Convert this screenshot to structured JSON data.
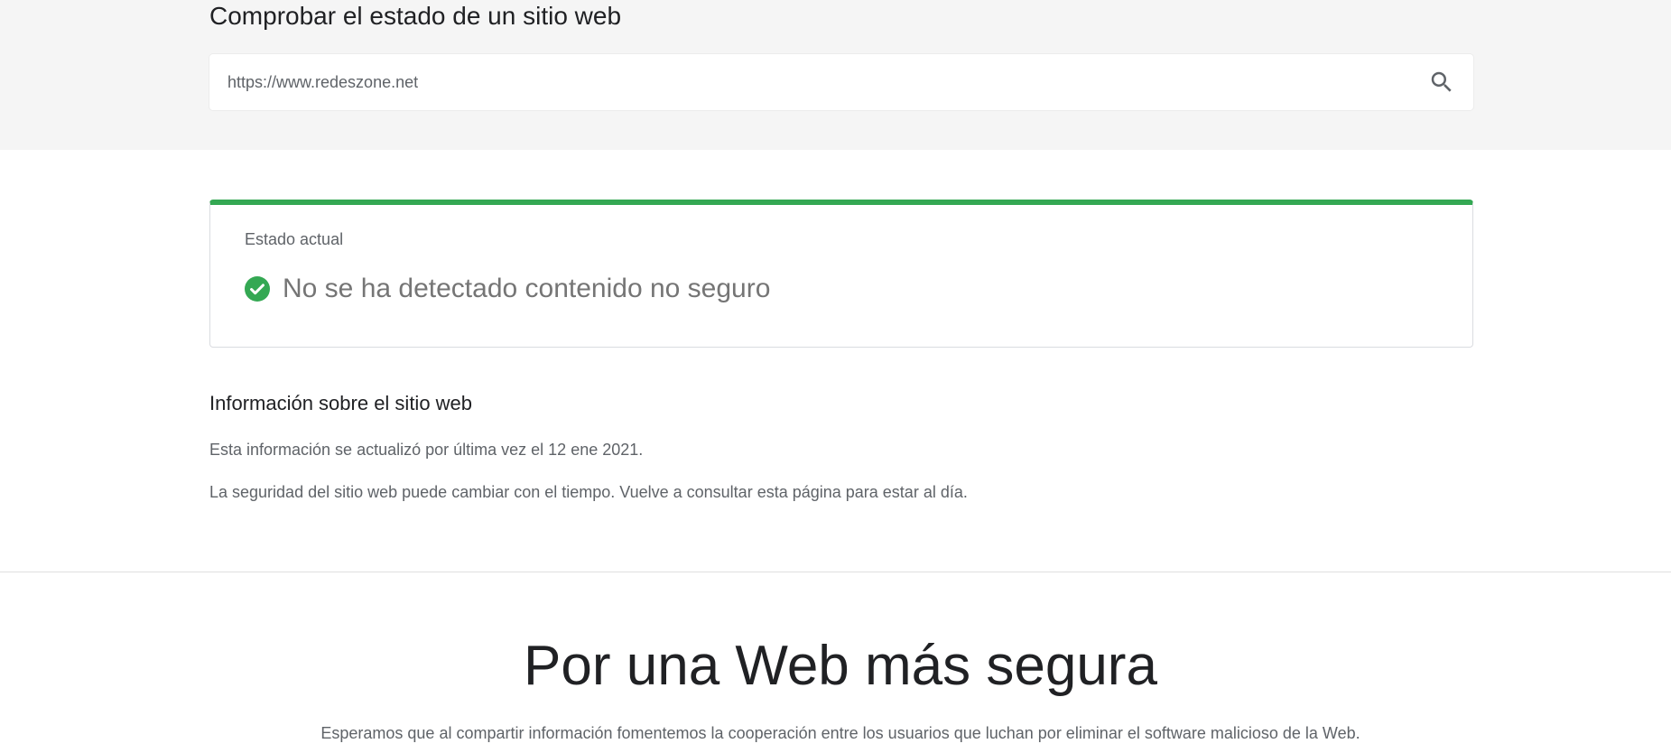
{
  "search_section": {
    "heading": "Comprobar el estado de un sitio web",
    "input_value": "https://www.redeszone.net",
    "search_icon": "search-icon"
  },
  "status_card": {
    "label": "Estado actual",
    "result_text": "No se ha detectado contenido no seguro",
    "result_icon": "check-circle-icon",
    "accent_color": "#34a853"
  },
  "site_info": {
    "heading": "Información sobre el sitio web",
    "updated_text": "Esta información se actualizó por última vez el 12 ene 2021.",
    "note_text": "La seguridad del sitio web puede cambiar con el tiempo. Vuelve a consultar esta página para estar al día."
  },
  "hero": {
    "title": "Por una Web más segura",
    "text": "Esperamos que al compartir información fomentemos la cooperación entre los usuarios que luchan por eliminar el software malicioso de la Web."
  }
}
